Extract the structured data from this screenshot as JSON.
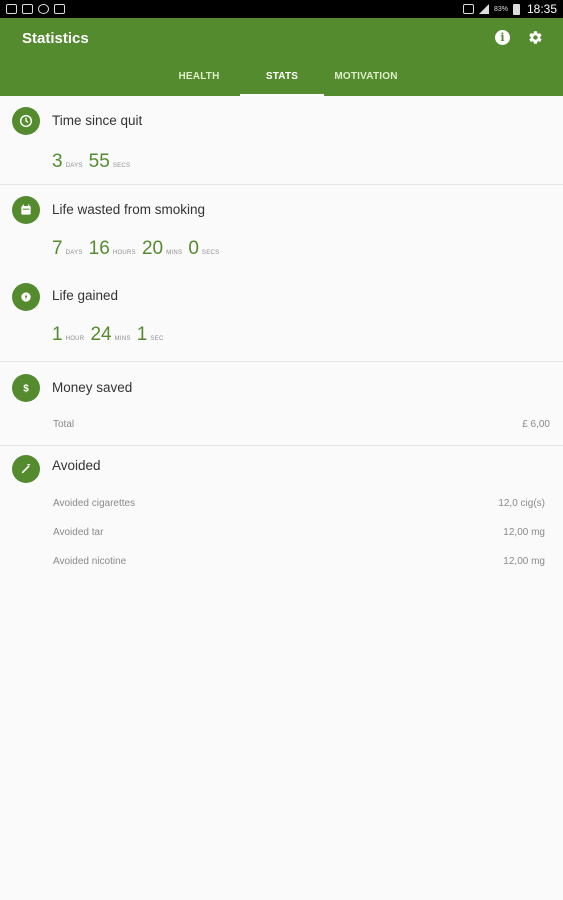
{
  "status_bar": {
    "battery": "83%",
    "time": "18:35"
  },
  "app": {
    "title": "Statistics"
  },
  "tabs": [
    {
      "label": "HEALTH"
    },
    {
      "label": "STATS"
    },
    {
      "label": "MOTIVATION"
    }
  ],
  "sections": {
    "time_since_quit": {
      "title": "Time since quit",
      "values": [
        {
          "value": "3",
          "unit": "DAYS"
        },
        {
          "value": "55",
          "unit": "SECS"
        }
      ]
    },
    "life_wasted": {
      "title": "Life wasted from smoking",
      "values": [
        {
          "value": "7",
          "unit": "DAYS"
        },
        {
          "value": "16",
          "unit": "HOURS"
        },
        {
          "value": "20",
          "unit": "MINS"
        },
        {
          "value": "0",
          "unit": "SECS"
        }
      ]
    },
    "life_gained": {
      "title": "Life gained",
      "values": [
        {
          "value": "1",
          "unit": "HOUR"
        },
        {
          "value": "24",
          "unit": "MINS"
        },
        {
          "value": "1",
          "unit": "SEC"
        }
      ]
    },
    "money_saved": {
      "title": "Money saved",
      "rows": [
        {
          "label": "Total",
          "value": "£ 6,00"
        }
      ]
    },
    "avoided": {
      "title": "Avoided",
      "rows": [
        {
          "label": "Avoided cigarettes",
          "value": "12,0 cig(s)"
        },
        {
          "label": "Avoided tar",
          "value": "12,00 mg"
        },
        {
          "label": "Avoided nicotine",
          "value": "12,00 mg"
        }
      ]
    }
  },
  "colors": {
    "primary": "#558b2f",
    "tab_inactive": "#dcedc8",
    "value_green": "#558b2f"
  },
  "icons": [
    "clock-icon",
    "calendar-icon",
    "heart-icon",
    "dollar-icon",
    "cigarette-icon",
    "info-icon",
    "gear-icon"
  ]
}
